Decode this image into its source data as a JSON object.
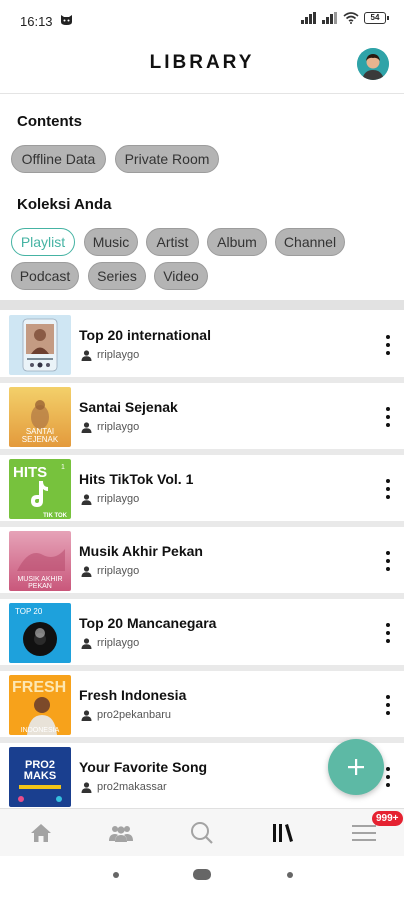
{
  "status_bar": {
    "time": "16:13",
    "battery": "54"
  },
  "header": {
    "title": "LIBRARY"
  },
  "contents": {
    "title": "Contents",
    "chips": [
      "Offline Data",
      "Private Room"
    ]
  },
  "koleksi": {
    "title": "Koleksi Anda",
    "chips": [
      "Playlist",
      "Music",
      "Artist",
      "Album",
      "Channel",
      "Podcast",
      "Series",
      "Video"
    ],
    "active": "Playlist"
  },
  "playlists": [
    {
      "title": "Top 20 international",
      "owner": "rriplaygo"
    },
    {
      "title": "Santai Sejenak",
      "owner": "rriplaygo",
      "thumb_text": [
        "SANTAI",
        "SEJENAK"
      ]
    },
    {
      "title": "Hits TikTok Vol. 1",
      "owner": "rriplaygo",
      "thumb_text": [
        "HITS",
        "1",
        "TIK TOK"
      ]
    },
    {
      "title": "Musik Akhir Pekan",
      "owner": "rriplaygo",
      "thumb_text": [
        "MUSIK AKHIR",
        "PEKAN"
      ]
    },
    {
      "title": "Top 20 Mancanegara",
      "owner": "rriplaygo",
      "thumb_text": [
        "TOP 20"
      ]
    },
    {
      "title": "Fresh Indonesia",
      "owner": "pro2pekanbaru",
      "thumb_text": [
        "FRESH",
        "INDONESIA"
      ]
    },
    {
      "title": "Your Favorite Song",
      "owner": "pro2makassar",
      "thumb_text": [
        "PRO2",
        "MAKS"
      ]
    }
  ],
  "bottom_nav": {
    "items": [
      "home-icon",
      "community-icon",
      "search-icon",
      "library-icon",
      "menu-icon"
    ],
    "badge": "999+"
  },
  "fab": {
    "icon": "plus-icon"
  },
  "colors": {
    "accent": "#45b3a3",
    "fab": "#5db9a5",
    "badge": "#e52231",
    "chip": "#b4b4b4"
  }
}
